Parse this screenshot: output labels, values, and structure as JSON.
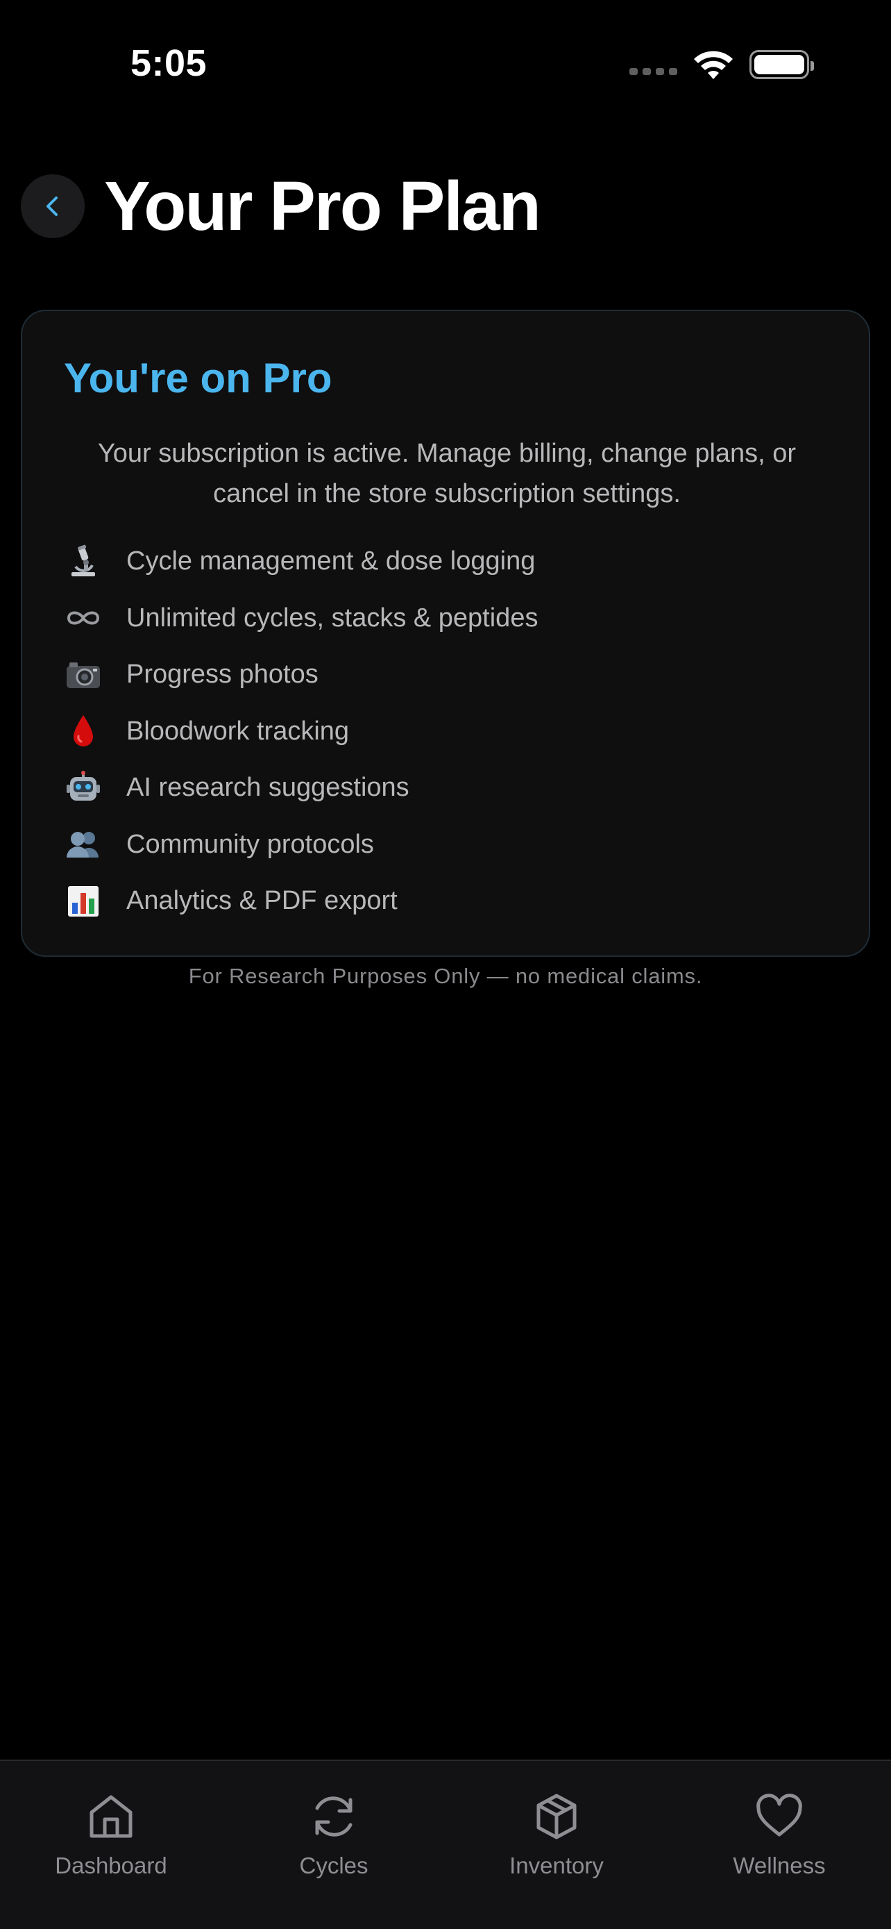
{
  "status_bar": {
    "time": "5:05"
  },
  "header": {
    "title": "Your Pro Plan",
    "back_icon": "chevron-left-icon"
  },
  "plan_card": {
    "title": "You're on Pro",
    "description": "Your subscription is active. Manage billing, change plans, or cancel in the store subscription settings.",
    "features": [
      {
        "icon": "microscope-icon",
        "label": "Cycle management & dose logging"
      },
      {
        "icon": "infinity-icon",
        "label": "Unlimited cycles, stacks & peptides"
      },
      {
        "icon": "camera-icon",
        "label": "Progress photos"
      },
      {
        "icon": "blood-drop-icon",
        "label": "Bloodwork tracking"
      },
      {
        "icon": "robot-icon",
        "label": "AI research suggestions"
      },
      {
        "icon": "people-icon",
        "label": "Community protocols"
      },
      {
        "icon": "bar-chart-icon",
        "label": "Analytics & PDF export"
      }
    ]
  },
  "disclaimer": "For Research Purposes Only — no medical claims.",
  "tab_bar": {
    "tabs": [
      {
        "icon": "home-icon",
        "label": "Dashboard"
      },
      {
        "icon": "refresh-icon",
        "label": "Cycles"
      },
      {
        "icon": "box-icon",
        "label": "Inventory"
      },
      {
        "icon": "heart-icon",
        "label": "Wellness"
      }
    ]
  },
  "colors": {
    "background": "#000000",
    "accent": "#4bb6ee",
    "card_background": "#0f0f10",
    "card_border": "#1f2c35",
    "muted_text": "#b8b8ba",
    "tab_label": "#8e8e93"
  }
}
